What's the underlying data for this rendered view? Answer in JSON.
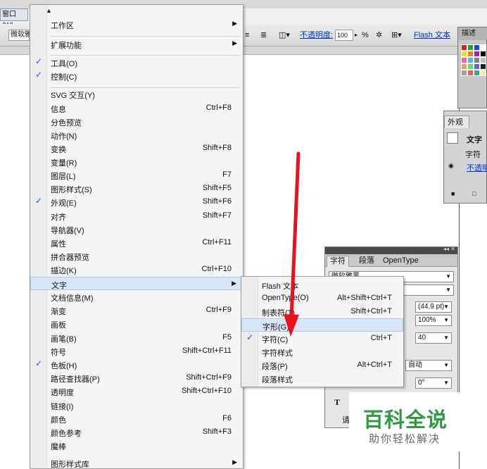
{
  "window_menu": {
    "label": "窗口(W)"
  },
  "control_bar": {
    "font_value": "微软雅",
    "opacity_label": "不透明度:",
    "opacity_value": "100",
    "percent": "%",
    "flash_text_label": "Flash 文本"
  },
  "main_menu": {
    "items": [
      {
        "label": "工作区",
        "shortcut": "",
        "submenu": true,
        "checked": false
      },
      {
        "label": "扩展功能",
        "shortcut": "",
        "submenu": true,
        "checked": false
      },
      {
        "label": "工具(O)",
        "shortcut": "",
        "submenu": false,
        "checked": true
      },
      {
        "label": "控制(C)",
        "shortcut": "",
        "submenu": false,
        "checked": true
      },
      {
        "label": "SVG 交互(Y)",
        "shortcut": "",
        "submenu": false,
        "checked": false
      },
      {
        "label": "信息",
        "shortcut": "Ctrl+F8",
        "submenu": false,
        "checked": false
      },
      {
        "label": "分色预览",
        "shortcut": "",
        "submenu": false,
        "checked": false
      },
      {
        "label": "动作(N)",
        "shortcut": "",
        "submenu": false,
        "checked": false
      },
      {
        "label": "变换",
        "shortcut": "Shift+F8",
        "submenu": false,
        "checked": false
      },
      {
        "label": "变量(R)",
        "shortcut": "",
        "submenu": false,
        "checked": false
      },
      {
        "label": "图层(L)",
        "shortcut": "F7",
        "submenu": false,
        "checked": false
      },
      {
        "label": "图形样式(S)",
        "shortcut": "Shift+F5",
        "submenu": false,
        "checked": false
      },
      {
        "label": "外观(E)",
        "shortcut": "Shift+F6",
        "submenu": false,
        "checked": true
      },
      {
        "label": "对齐",
        "shortcut": "Shift+F7",
        "submenu": false,
        "checked": false
      },
      {
        "label": "导航器(V)",
        "shortcut": "",
        "submenu": false,
        "checked": false
      },
      {
        "label": "属性",
        "shortcut": "Ctrl+F11",
        "submenu": false,
        "checked": false
      },
      {
        "label": "拼合器预览",
        "shortcut": "",
        "submenu": false,
        "checked": false
      },
      {
        "label": "描边(K)",
        "shortcut": "Ctrl+F10",
        "submenu": false,
        "checked": false
      },
      {
        "label": "文字",
        "shortcut": "",
        "submenu": true,
        "checked": false,
        "highlighted": true
      },
      {
        "label": "文档信息(M)",
        "shortcut": "",
        "submenu": false,
        "checked": false
      },
      {
        "label": "渐变",
        "shortcut": "Ctrl+F9",
        "submenu": false,
        "checked": false
      },
      {
        "label": "画板",
        "shortcut": "",
        "submenu": false,
        "checked": false
      },
      {
        "label": "画笔(B)",
        "shortcut": "F5",
        "submenu": false,
        "checked": false
      },
      {
        "label": "符号",
        "shortcut": "Shift+Ctrl+F11",
        "submenu": false,
        "checked": false
      },
      {
        "label": "色板(H)",
        "shortcut": "",
        "submenu": false,
        "checked": true
      },
      {
        "label": "路径查找器(P)",
        "shortcut": "Shift+Ctrl+F9",
        "submenu": false,
        "checked": false
      },
      {
        "label": "透明度",
        "shortcut": "Shift+Ctrl+F10",
        "submenu": false,
        "checked": false
      },
      {
        "label": "链接(I)",
        "shortcut": "",
        "submenu": false,
        "checked": false
      },
      {
        "label": "颜色",
        "shortcut": "F6",
        "submenu": false,
        "checked": false
      },
      {
        "label": "颜色参考",
        "shortcut": "Shift+F3",
        "submenu": false,
        "checked": false
      },
      {
        "label": "魔棒",
        "shortcut": "",
        "submenu": false,
        "checked": false
      },
      {
        "label": "图形样式库",
        "shortcut": "",
        "submenu": true,
        "checked": false
      }
    ]
  },
  "type_submenu": {
    "items": [
      {
        "label": "Flash 文本",
        "shortcut": "",
        "checked": false
      },
      {
        "label": "OpenType(O)",
        "shortcut": "Alt+Shift+Ctrl+T",
        "checked": false
      },
      {
        "label": "制表符(T)",
        "shortcut": "Shift+Ctrl+T",
        "checked": false
      },
      {
        "label": "字形(G)",
        "shortcut": "",
        "checked": false,
        "highlighted": true
      },
      {
        "label": "字符(C)",
        "shortcut": "Ctrl+T",
        "checked": true
      },
      {
        "label": "字符样式",
        "shortcut": "",
        "checked": false
      },
      {
        "label": "段落(P)",
        "shortcut": "Alt+Ctrl+T",
        "checked": false
      },
      {
        "label": "段落样式",
        "shortcut": "",
        "checked": false
      }
    ]
  },
  "swatch_panel": {
    "tab_label": "描述",
    "colors": [
      "#e02020",
      "#20a030",
      "#2040e0",
      "#ffffff",
      "#f0e020",
      "#f08020",
      "#a020c0",
      "#000000",
      "#ff60a0",
      "#40c0e0",
      "#808080",
      "#c0c0c0",
      "#e0a060",
      "#60e060",
      "#6060e0",
      "#202020",
      "#a0a0a0",
      "#e06060",
      "#40a0a0",
      "#f0f0a0"
    ]
  },
  "appearance_panel": {
    "tab_label": "外观",
    "object_label": "文字",
    "char_label": "字符",
    "opacity_link": "不透明"
  },
  "character_panel": {
    "tabs": [
      "字符",
      "段落",
      "OpenType"
    ],
    "font_family": "微软雅黑",
    "font_size": "(44.9 pt)",
    "scale": "100%",
    "tracking": "40",
    "auto": "自动",
    "rotation": "0°",
    "type_icon": "T",
    "bottom_text": "请"
  },
  "watermark": {
    "title": "百科全说",
    "subtitle": "助你轻松解决"
  },
  "icons": {
    "check": "check-icon",
    "submenu_arrow": "chevron-right-icon",
    "scroll_up": "scroll-up-icon"
  }
}
